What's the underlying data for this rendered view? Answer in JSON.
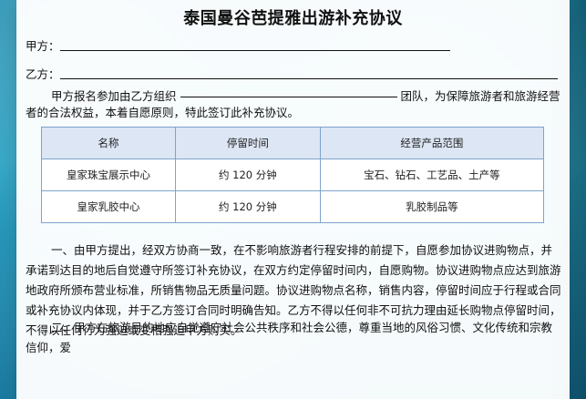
{
  "document": {
    "title": "泰国曼谷芭提雅出游补充协议",
    "party_a_label": "甲方：",
    "party_b_label": "乙方：",
    "intro_part1": "甲方报名参加由乙方组织",
    "intro_part2": "团队，为保障旅游者和旅游经营者的合法权益，本着自愿原则，特此签订此补充协议。",
    "table": {
      "headers": [
        "名称",
        "停留时间",
        "经营产品范围"
      ],
      "rows": [
        [
          "皇家珠宝展示中心",
          "约 120 分钟",
          "宝石、钻石、工艺品、土产等"
        ],
        [
          "皇家乳胶中心",
          "约 120 分钟",
          "乳胶制品等"
        ]
      ]
    },
    "para1": "一、由甲方提出，经双方协商一致，在不影响旅游者行程安排的前提下，自愿参加协议进购物点，并承诺到达目的地后自觉遵守所签订补充协议，在双方约定停留时间内，自愿购物。协议进购物点应达到旅游地政府所颁布营业标准，所销售物品无质量问题。协议进购物点名称，销售内容，停留时间应于行程或合同或补充协议内体现，并于乙方签订合同时明确告知。乙方不得以任何非不可抗力理由延长购物点停留时间，不得以任何行为强迫或变相强迫甲方购买。",
    "para2": "二、甲方在旅游目的地应自觉遵守社会公共秩序和社会公德，尊重当地的风俗习惯、文化传统和宗教信仰，爱"
  }
}
